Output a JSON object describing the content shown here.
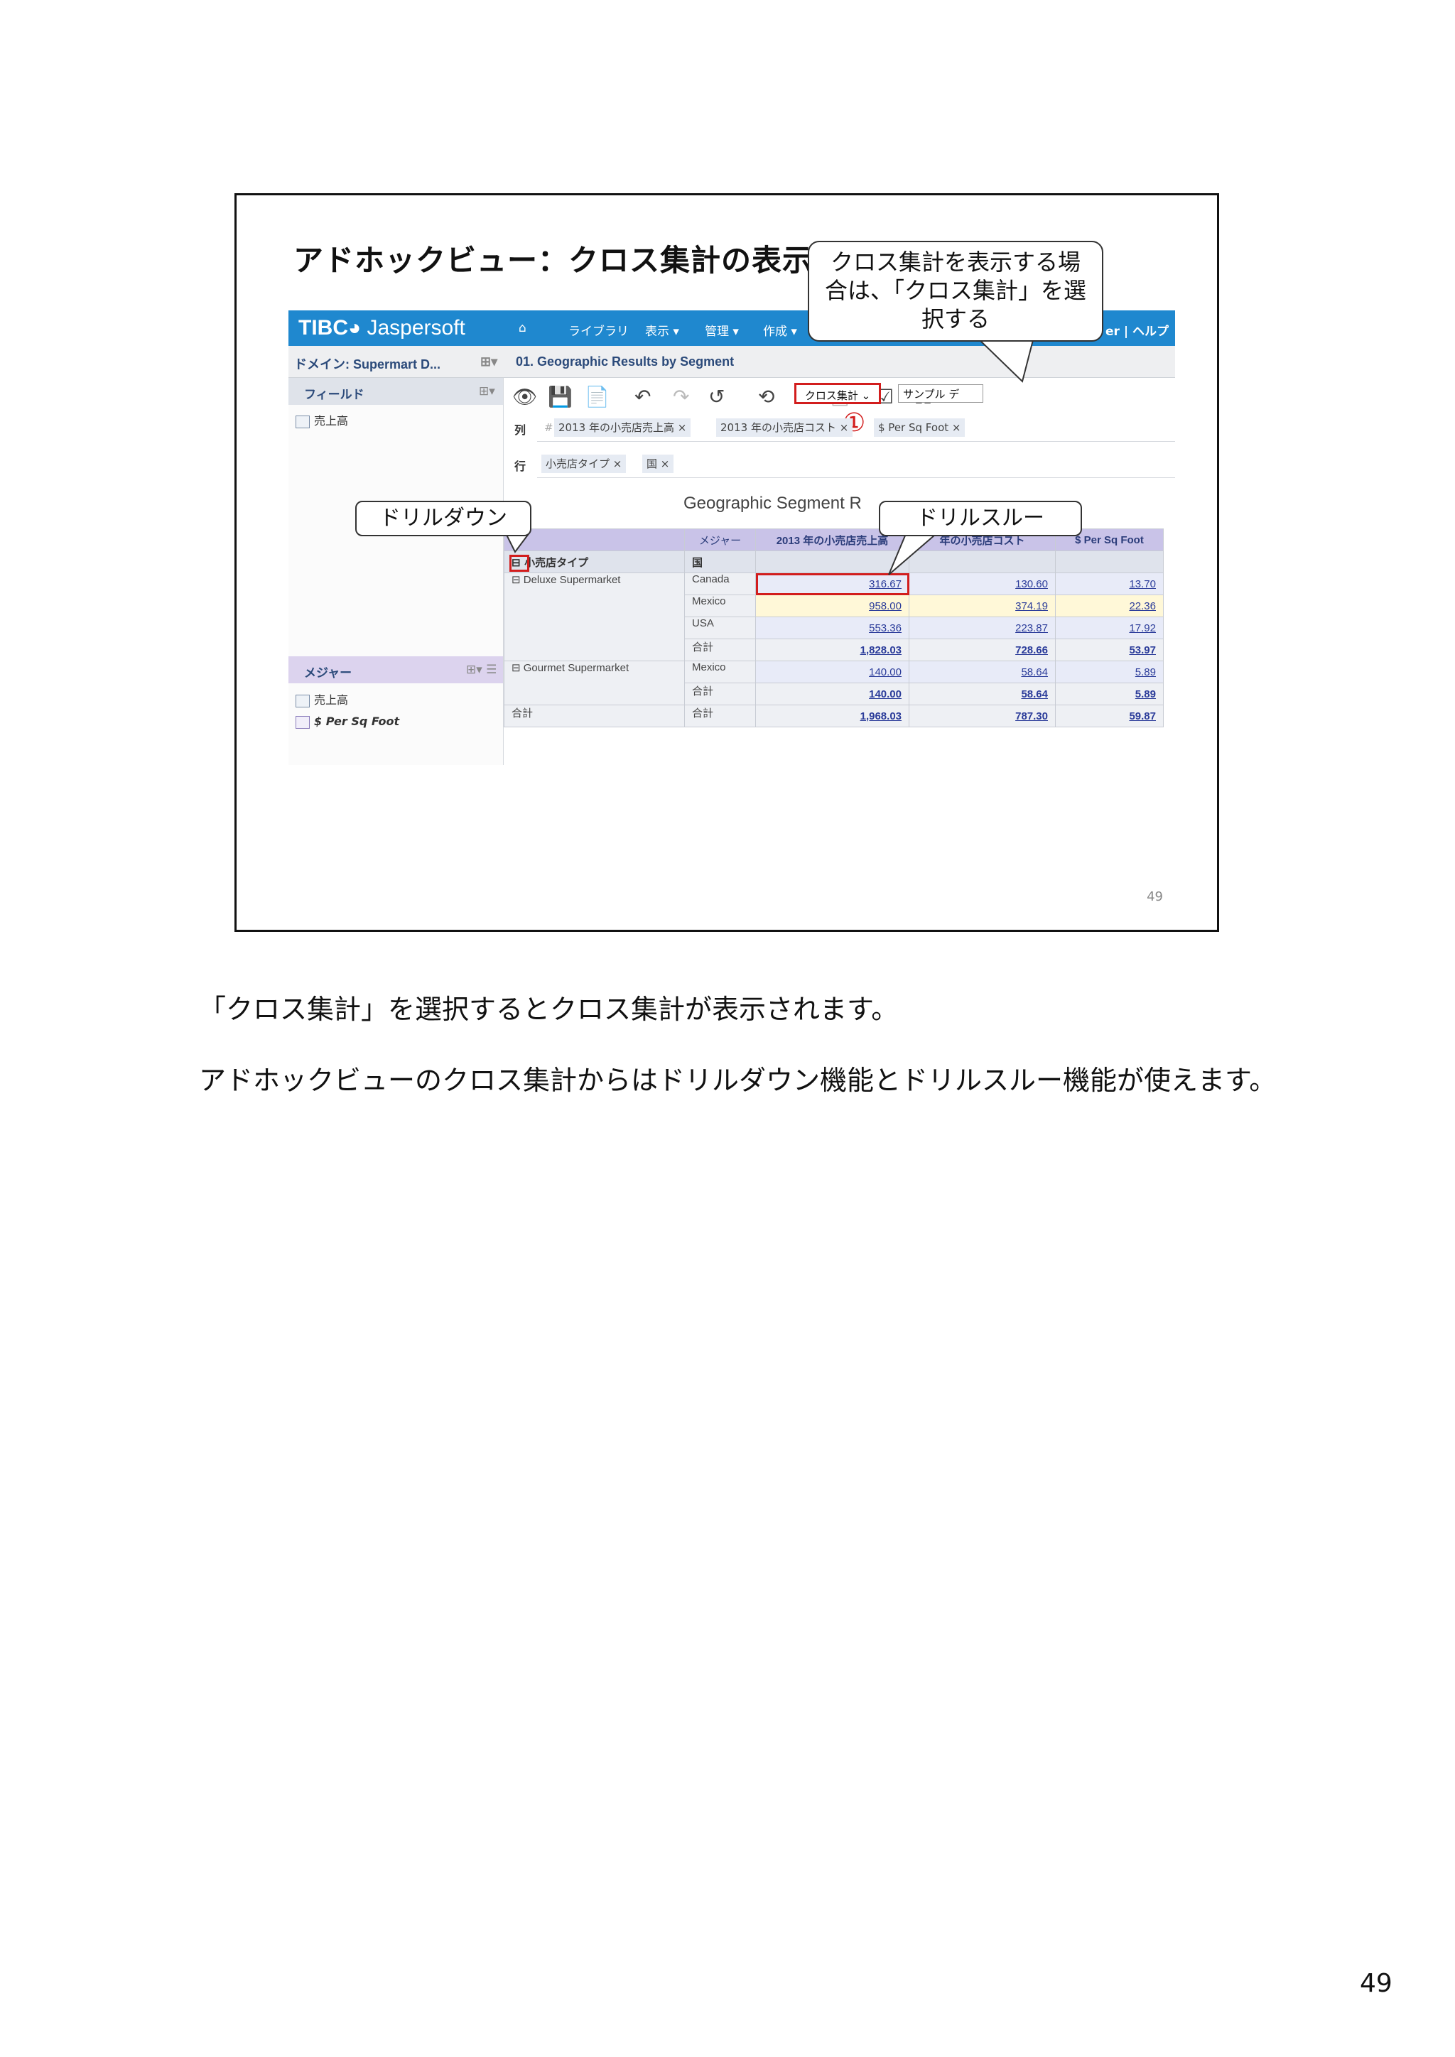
{
  "slide": {
    "title": "アドホックビュー：クロス集計の表示",
    "number": "49"
  },
  "app": {
    "logo_brand": "TIBC",
    "logo_product": "Jaspersoft",
    "nav": [
      "ライブラリ",
      "表示",
      "管理",
      "作成"
    ],
    "nav_right": "er | ヘルプ",
    "domain_label": "ドメイン: Supermart D...",
    "view_title": "01. Geographic Results by Segment",
    "fields_title": "フィールド",
    "fields": [
      "売上高"
    ],
    "measures_title": "メジャー",
    "measures": [
      "売上高",
      "$ Per Sq Foot"
    ],
    "view_mode": "クロス集計",
    "sample_data": "サンプル デ",
    "columns_label": "列",
    "rows_label": "行",
    "column_chips": [
      "2013 年の小売店売上高",
      "2013 年の小売店コスト",
      "$ Per Sq Foot"
    ],
    "row_chips": [
      "小売店タイプ",
      "国"
    ],
    "report_title": "Geographic Segment R",
    "crosstab": {
      "measure_header": "メジャー",
      "col_headers": [
        "2013 年の小売店売上高",
        "年の小売店コスト",
        "$ Per Sq Foot"
      ],
      "row_dim1": "小売店タイプ",
      "row_dim2": "国",
      "groups": [
        {
          "name": "Deluxe Supermarket",
          "rows": [
            {
              "country": "Canada",
              "values": [
                "316.67",
                "130.60",
                "13.70"
              ]
            },
            {
              "country": "Mexico",
              "values": [
                "958.00",
                "374.19",
                "22.36"
              ]
            },
            {
              "country": "USA",
              "values": [
                "553.36",
                "223.87",
                "17.92"
              ]
            },
            {
              "country": "合計",
              "values": [
                "1,828.03",
                "728.66",
                "53.97"
              ]
            }
          ]
        },
        {
          "name": "Gourmet Supermarket",
          "rows": [
            {
              "country": "Mexico",
              "values": [
                "140.00",
                "58.64",
                "5.89"
              ]
            },
            {
              "country": "合計",
              "values": [
                "140.00",
                "58.64",
                "5.89"
              ]
            }
          ]
        }
      ],
      "grand_total_label": "合計",
      "grand_total_sub": "合計",
      "grand_total": [
        "1,968.03",
        "787.30",
        "59.87"
      ]
    }
  },
  "callouts": {
    "cross_line1": "クロス集計を表示する場",
    "cross_line2": "合は、「クロス集計」を選",
    "cross_line3": "択する",
    "circle_marker": "①",
    "drilldown": "ドリルダウン",
    "drillthrough": "ドリルスルー"
  },
  "body": {
    "para1": "「クロス集計」を選択するとクロス集計が表示されます。",
    "para2": "アドホックビューのクロス集計からはドリルダウン機能とドリルスルー機能が使えます。"
  },
  "page_number": "49"
}
